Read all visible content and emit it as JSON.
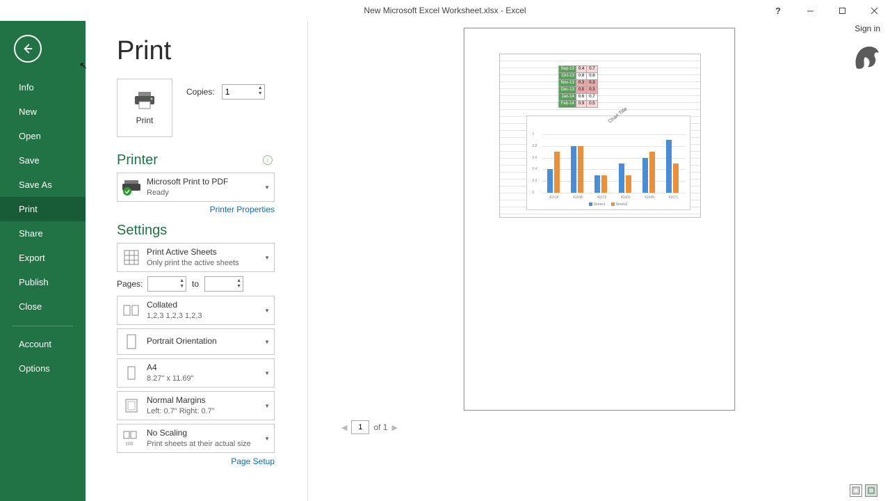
{
  "titlebar": {
    "title": "New Microsoft Excel Worksheet.xlsx - Excel"
  },
  "signin": "Sign in",
  "sidebar": {
    "items": [
      {
        "label": "Info"
      },
      {
        "label": "New"
      },
      {
        "label": "Open"
      },
      {
        "label": "Save"
      },
      {
        "label": "Save As"
      },
      {
        "label": "Print"
      },
      {
        "label": "Share"
      },
      {
        "label": "Export"
      },
      {
        "label": "Publish"
      },
      {
        "label": "Close"
      }
    ],
    "account": "Account",
    "options": "Options"
  },
  "page": {
    "title": "Print"
  },
  "print": {
    "button_label": "Print",
    "copies_label": "Copies:",
    "copies_value": "1"
  },
  "printer": {
    "heading": "Printer",
    "name": "Microsoft Print to PDF",
    "status": "Ready",
    "properties_link": "Printer Properties"
  },
  "settings": {
    "heading": "Settings",
    "what": {
      "title": "Print Active Sheets",
      "sub": "Only print the active sheets"
    },
    "pages_label": "Pages:",
    "to_label": "to",
    "pages_from": "",
    "pages_to": "",
    "collate": {
      "title": "Collated",
      "sub": "1,2,3    1,2,3    1,2,3"
    },
    "orientation": {
      "title": "Portrait Orientation"
    },
    "paper": {
      "title": "A4",
      "sub": "8.27\" x 11.69\""
    },
    "margins": {
      "title": "Normal Margins",
      "sub": "Left:  0.7\"    Right:  0.7\""
    },
    "scaling": {
      "title": "No Scaling",
      "sub": "Print sheets at their actual size"
    },
    "page_setup_link": "Page Setup"
  },
  "preview_nav": {
    "page": "1",
    "of_label": "of 1"
  },
  "chart_data": {
    "table": {
      "rows": [
        {
          "label": "Sep-13",
          "a": 0.4,
          "b": 0.7
        },
        {
          "label": "Oct-13",
          "a": 0.8,
          "b": 0.8
        },
        {
          "label": "Nov-13",
          "a": 0.3,
          "b": 0.3
        },
        {
          "label": "Dec-13",
          "a": 0.5,
          "b": 0.3
        },
        {
          "label": "Jan-14",
          "a": 0.6,
          "b": 0.7
        },
        {
          "label": "Feb-14",
          "a": 0.9,
          "b": 0.5
        }
      ]
    },
    "chart": {
      "type": "bar",
      "title": "Chart Title",
      "categories": [
        "41518",
        "41548",
        "41579",
        "41609",
        "41640",
        "41671"
      ],
      "series": [
        {
          "name": "Series1",
          "values": [
            0.4,
            0.8,
            0.3,
            0.5,
            0.6,
            0.9
          ],
          "color": "#4a8dd6"
        },
        {
          "name": "Series2",
          "values": [
            0.7,
            0.8,
            0.3,
            0.3,
            0.7,
            0.5
          ],
          "color": "#ea8f3c"
        }
      ],
      "ylabel": "",
      "xlabel": "",
      "ylim": [
        0,
        1
      ],
      "yticks": [
        0,
        0.2,
        0.4,
        0.6,
        0.8,
        1
      ]
    }
  }
}
